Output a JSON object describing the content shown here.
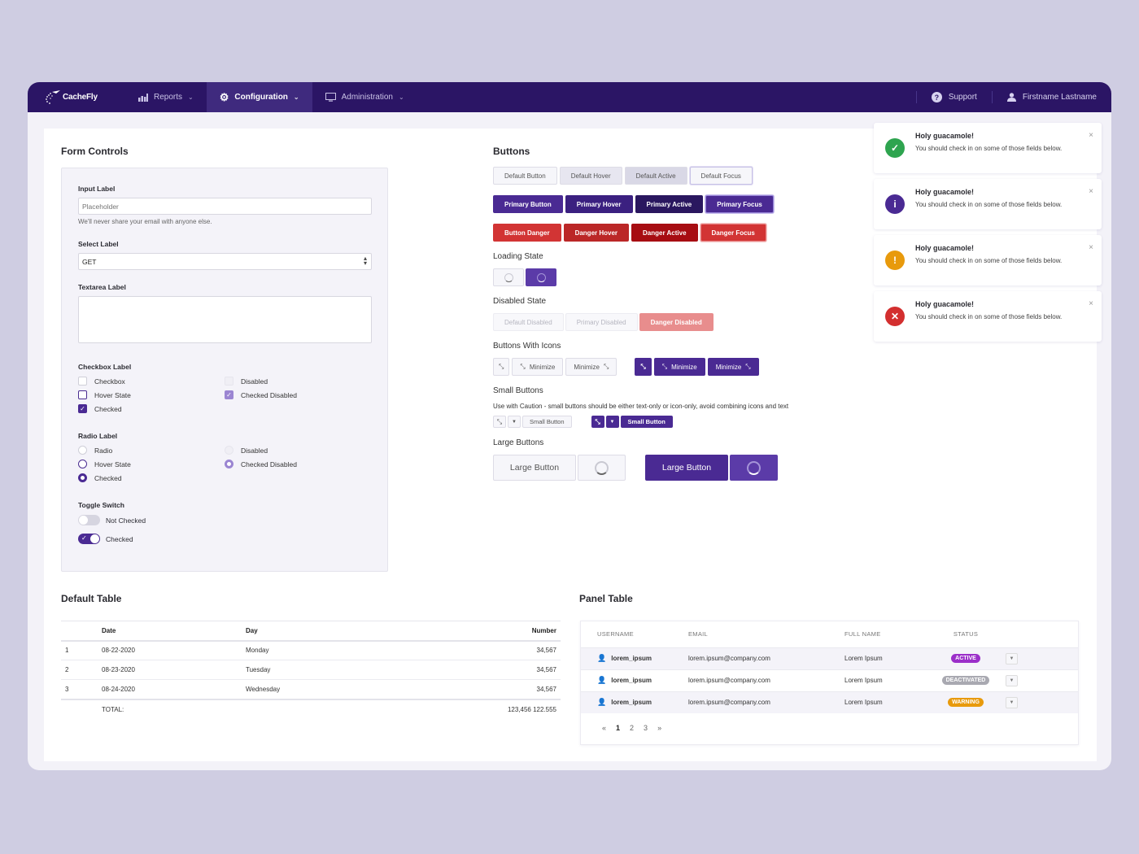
{
  "nav": {
    "brand": "CacheFly",
    "items": [
      {
        "label": "Reports",
        "icon": "bar-chart-icon",
        "active": false
      },
      {
        "label": "Configuration",
        "icon": "gear-icon",
        "active": true
      },
      {
        "label": "Administration",
        "icon": "monitor-icon",
        "active": false
      }
    ],
    "support": "Support",
    "user": "Firstname Lastname"
  },
  "form": {
    "title": "Form Controls",
    "input_label": "Input Label",
    "input_placeholder": "Placeholder",
    "input_value": "",
    "input_help": "We'll never share your email with anyone else.",
    "select_label": "Select Label",
    "select_value": "GET",
    "textarea_label": "Textarea Label",
    "textarea_value": "",
    "checkbox_label": "Checkbox Label",
    "checkboxes": [
      {
        "label": "Checkbox",
        "state": "default"
      },
      {
        "label": "Hover State",
        "state": "hover"
      },
      {
        "label": "Checked",
        "state": "checked"
      },
      {
        "label": "Disabled",
        "state": "disabled"
      },
      {
        "label": "Checked Disabled",
        "state": "checked-disabled"
      }
    ],
    "radio_label": "Radio Label",
    "radios": [
      {
        "label": "Radio",
        "state": "default"
      },
      {
        "label": "Hover State",
        "state": "hover"
      },
      {
        "label": "Checked",
        "state": "checked"
      },
      {
        "label": "Disabled",
        "state": "disabled"
      },
      {
        "label": "Checked Disabled",
        "state": "checked-disabled"
      }
    ],
    "toggle_label": "Toggle Switch",
    "toggles": [
      {
        "label": "Not Checked",
        "on": false
      },
      {
        "label": "Checked",
        "on": true
      }
    ]
  },
  "buttons": {
    "title": "Buttons",
    "default_row": [
      "Default Button",
      "Default Hover",
      "Default Active",
      "Default Focus"
    ],
    "primary_row": [
      "Primary Button",
      "Primary Hover",
      "Primary Active",
      "Primary Focus"
    ],
    "danger_row": [
      "Button Danger",
      "Danger Hover",
      "Danger Active",
      "Danger Focus"
    ],
    "loading_title": "Loading State",
    "disabled_title": "Disabled State",
    "disabled_row": [
      "Default Disabled",
      "Primary Disabled",
      "Danger Disabled"
    ],
    "icons_title": "Buttons With Icons",
    "minimize_label": "Minimize",
    "small_title": "Small Buttons",
    "small_help": "Use with Caution - small buttons should be either text-only or icon-only, avoid combining icons and text",
    "small_label": "Small Button",
    "large_title": "Large Buttons",
    "large_label": "Large Button"
  },
  "alerts": [
    {
      "type": "success",
      "color": "#2ea44f",
      "icon": "check-icon",
      "glyph": "✓",
      "title": "Holy guacamole!",
      "message": "You should check in on some of those fields below."
    },
    {
      "type": "info",
      "color": "#4a2a93",
      "icon": "info-icon",
      "glyph": "i",
      "title": "Holy guacamole!",
      "message": "You should check in on some of those fields below."
    },
    {
      "type": "warning",
      "color": "#e89a0c",
      "icon": "exclamation-icon",
      "glyph": "!",
      "title": "Holy guacamole!",
      "message": "You should check in on some of those fields below."
    },
    {
      "type": "danger",
      "color": "#d32f2f",
      "icon": "x-icon",
      "glyph": "✕",
      "title": "Holy guacamole!",
      "message": "You should check in on some of those fields below."
    }
  ],
  "default_table": {
    "title": "Default Table",
    "headers": [
      "",
      "Date",
      "Day",
      "Number"
    ],
    "rows": [
      [
        "1",
        "08-22-2020",
        "Monday",
        "34,567"
      ],
      [
        "2",
        "08-23-2020",
        "Tuesday",
        "34,567"
      ],
      [
        "3",
        "08-24-2020",
        "Wednesday",
        "34,567"
      ]
    ],
    "total_label": "TOTAL:",
    "total_value": "123,456 122.555"
  },
  "panel_table": {
    "title": "Panel Table",
    "headers": [
      "USERNAME",
      "EMAIL",
      "FULL NAME",
      "STATUS"
    ],
    "rows": [
      {
        "username": "lorem_ipsum",
        "email": "lorem.ipsum@company.com",
        "full_name": "Lorem Ipsum",
        "status": "ACTIVE",
        "status_color": "#9b2fc9"
      },
      {
        "username": "lorem_ipsum",
        "email": "lorem.ipsum@company.com",
        "full_name": "Lorem Ipsum",
        "status": "DEACTIVATED",
        "status_color": "#a9a9b1"
      },
      {
        "username": "lorem_ipsum",
        "email": "lorem.ipsum@company.com",
        "full_name": "Lorem Ipsum",
        "status": "WARNING",
        "status_color": "#e89a0c"
      }
    ],
    "pagination": {
      "prev": "«",
      "pages": [
        "1",
        "2",
        "3"
      ],
      "current": "1",
      "next": "»"
    }
  },
  "colors": {
    "brand": "#2b1565",
    "primary": "#4a2a93",
    "danger": "#d23434"
  }
}
